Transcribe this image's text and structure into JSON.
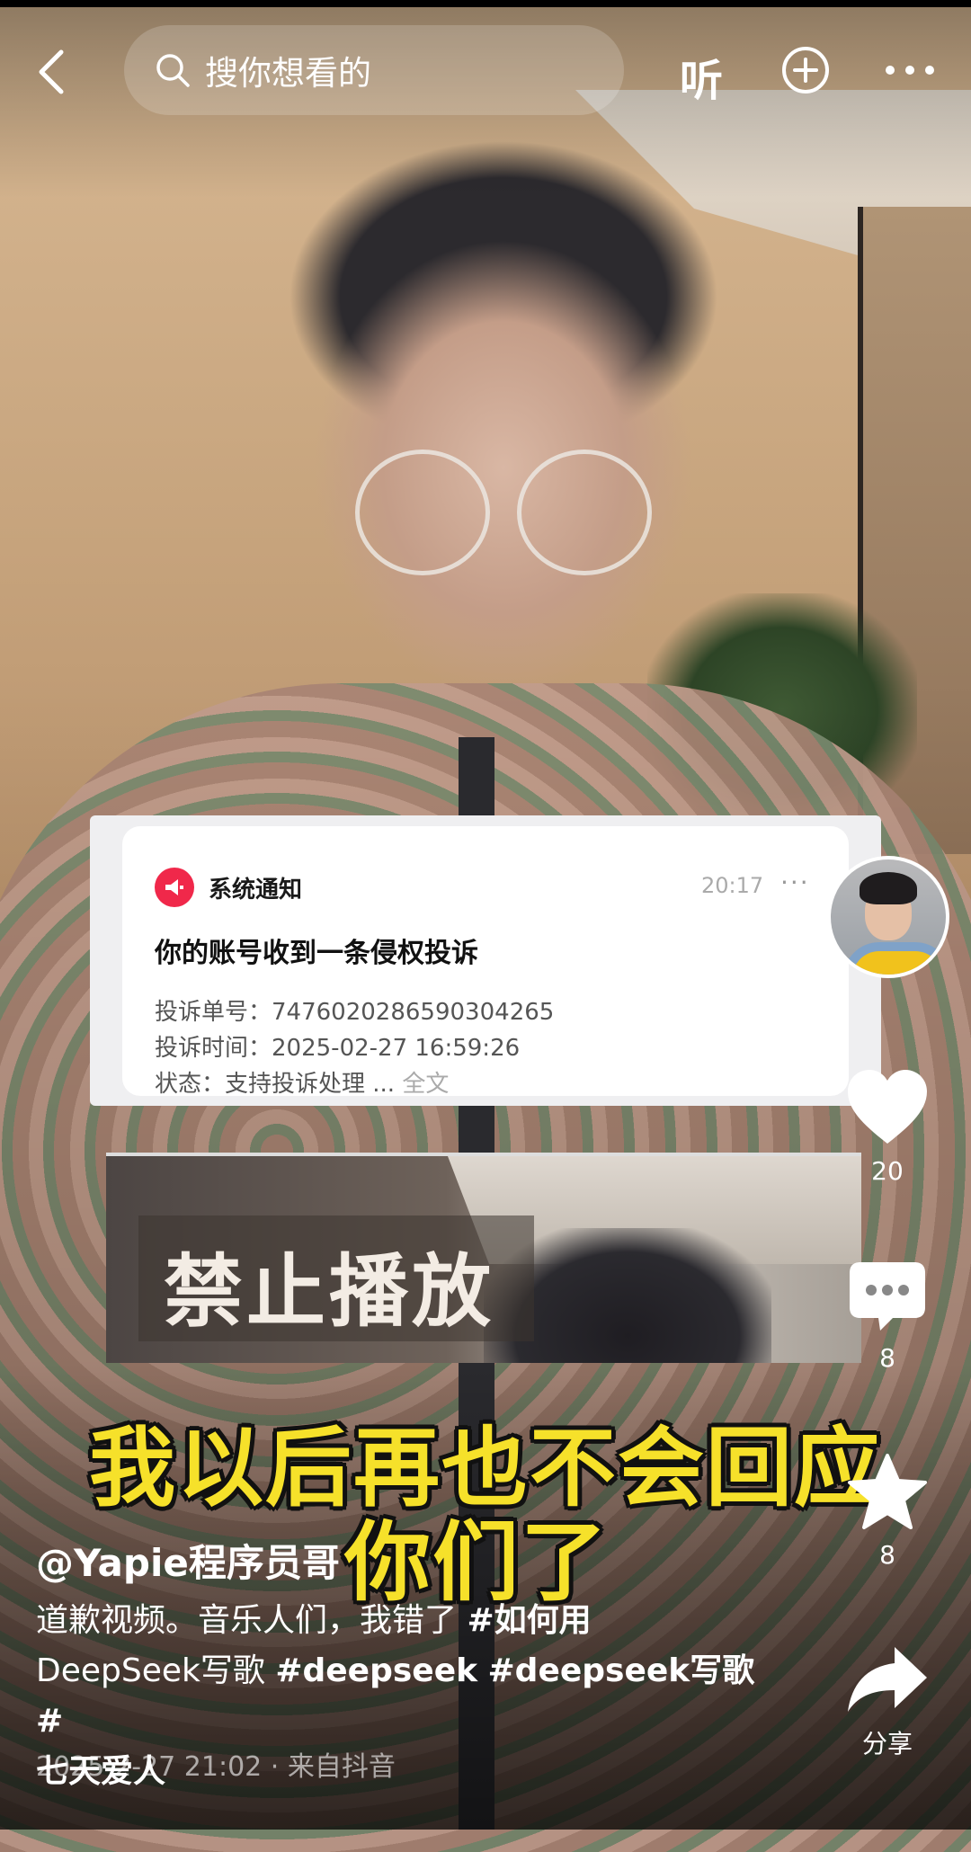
{
  "search": {
    "placeholder": "搜你想看的"
  },
  "topbar": {
    "listen_label": "听"
  },
  "notification": {
    "title": "系统通知",
    "time": "20:17",
    "more": "···",
    "heading": "你的账号收到一条侵权投诉",
    "complaint_no_label": "投诉单号：",
    "complaint_no": "7476020286590304265",
    "complaint_time_label": "投诉时间：",
    "complaint_time": "2025-02-27 16:59:26",
    "status_label": "状态：",
    "status": "支持投诉处理 ...",
    "full_text": "全文"
  },
  "inset": {
    "banner": "禁止播放"
  },
  "subtitles": {
    "line1": "我以后再也不会回应",
    "line2": "你们了"
  },
  "rail": {
    "like_count": "20",
    "comment_count": "8",
    "favorite_count": "8",
    "share_label": "分享"
  },
  "post": {
    "author": "@Yapie程序员哥",
    "desc_text_1": "道歉视频。音乐人们，我错了 ",
    "tag_1": "#如何用",
    "desc_line_2_plain": "DeepSeek写歌 ",
    "tag_2": "#deepseek",
    "tag_3": "#deepseek写歌",
    "tag_4_start": "#",
    "tag_4_end": "七天爱人",
    "meta": "2025-2-27 21:02 · 来自抖音"
  },
  "colors": {
    "subtitle": "#f6e12a",
    "notification_icon": "#f0284a"
  },
  "icons": [
    "back-icon",
    "search-icon",
    "add-circle-icon",
    "more-icon",
    "megaphone-icon",
    "heart-icon",
    "comment-icon",
    "star-icon",
    "share-icon"
  ]
}
